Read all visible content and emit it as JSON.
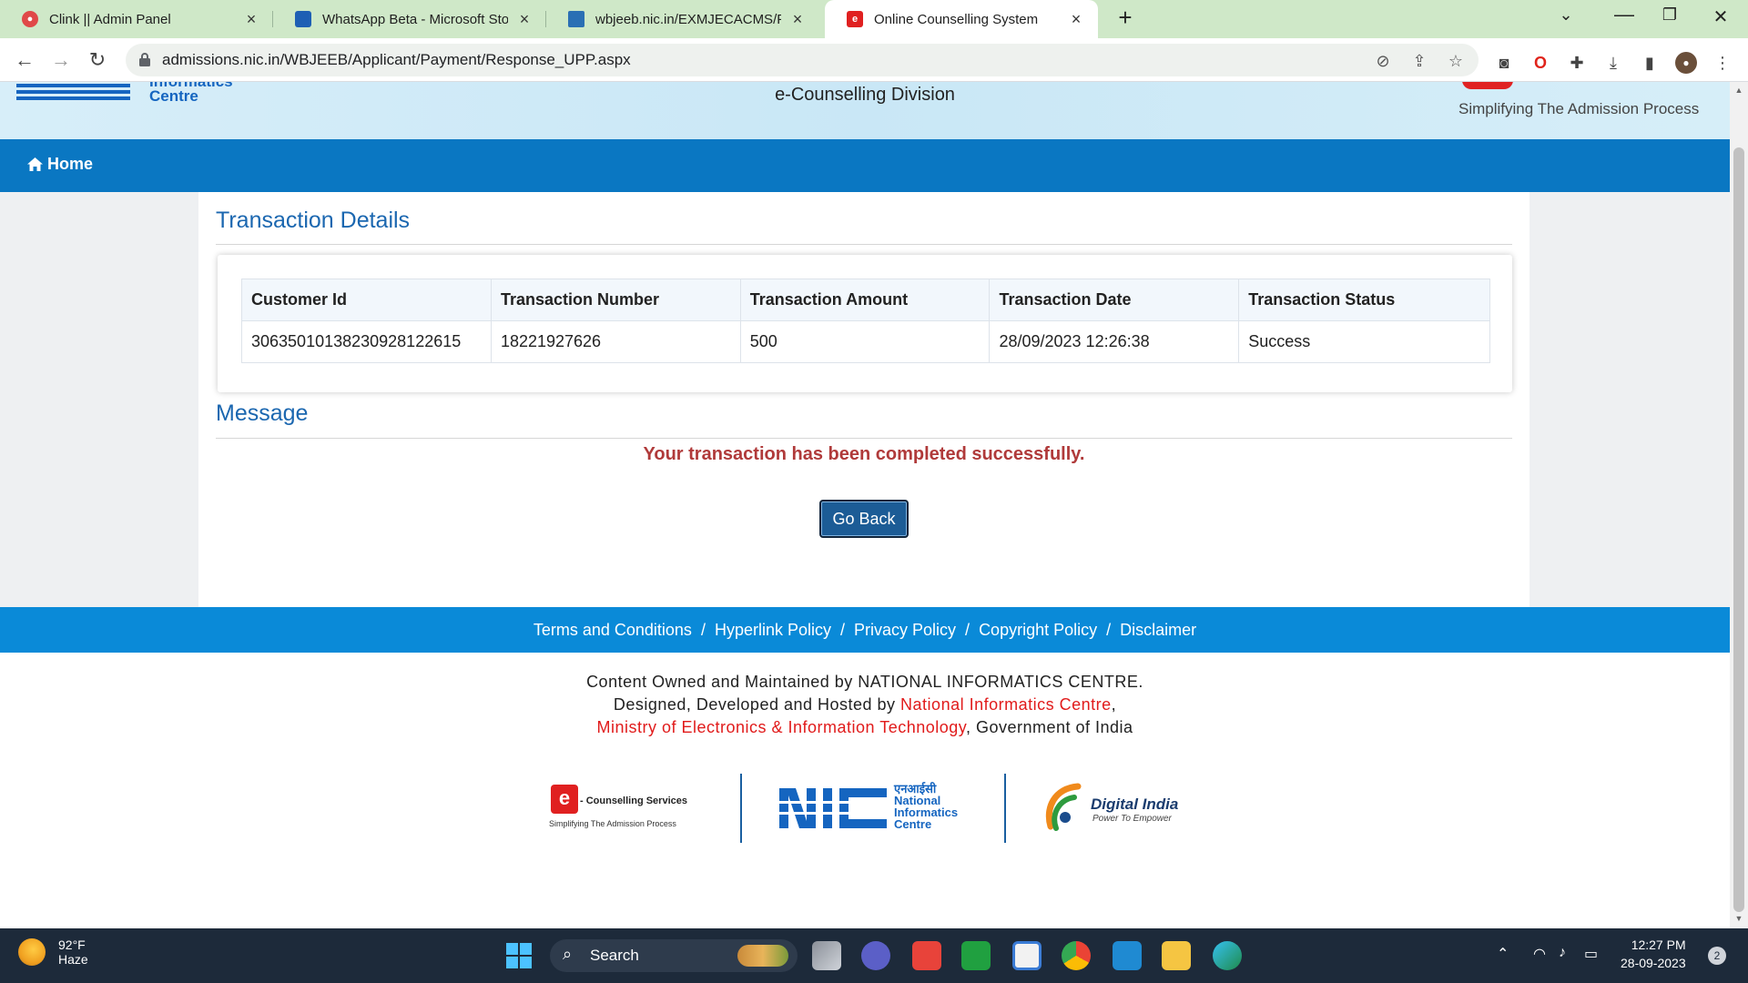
{
  "browser": {
    "tabs": [
      {
        "label": "Clink || Admin Panel",
        "close": "×"
      },
      {
        "label": "WhatsApp Beta - Microsoft Store",
        "close": "×"
      },
      {
        "label": "wbjeeb.nic.in/EXMJECACMS/Page",
        "close": "×"
      },
      {
        "label": "Online Counselling System",
        "close": "×",
        "active": true
      }
    ],
    "new_tab": "+",
    "url": "admissions.nic.in/WBJEEB/Applicant/Payment/Response_UPP.aspx"
  },
  "header": {
    "nic_logo_text_line1": "Informatics",
    "nic_logo_text_line2": "Centre",
    "division": "e-Counselling Division",
    "tagline": "Simplifying The Admission Process"
  },
  "nav": {
    "home": "Home"
  },
  "transaction": {
    "section_title": "Transaction Details",
    "columns": [
      "Customer Id",
      "Transaction Number",
      "Transaction Amount",
      "Transaction Date",
      "Transaction Status"
    ],
    "row": [
      "30635010138230928122615",
      "18221927626",
      "500",
      "28/09/2023 12:26:38",
      "Success"
    ]
  },
  "message": {
    "section_title": "Message",
    "text": "Your transaction has been completed successfully.",
    "button": "Go Back"
  },
  "footer": {
    "links": [
      "Terms and Conditions",
      "Hyperlink Policy",
      "Privacy Policy",
      "Copyright Policy",
      "Disclaimer"
    ],
    "separator": "/",
    "line1": "Content Owned and Maintained by NATIONAL INFORMATICS CENTRE.",
    "line2_prefix": "Designed, Developed and Hosted by ",
    "line2_link": "National Informatics Centre",
    "line2_suffix": ",",
    "line3_link": "Ministry of Electronics & Information Technology",
    "line3_suffix": ", Government of India",
    "logo1_title": "- Counselling Services",
    "logo1_sub": "Simplifying The Admission Process",
    "logo2_hindi": "एनआईसी",
    "logo2_line1": "National",
    "logo2_line2": "Informatics",
    "logo2_line3": "Centre",
    "logo3_title": "Digital India",
    "logo3_sub": "Power To Empower"
  },
  "taskbar": {
    "temperature": "92°F",
    "weather": "Haze",
    "search": "Search",
    "time": "12:27 PM",
    "date": "28-09-2023",
    "notifications": "2"
  },
  "colors": {
    "navbar": "#0a77c2",
    "section_title": "#1b67b0",
    "success_text": "#b03a3a",
    "footer_bar": "#0a8ad8",
    "accent_red": "#e11b1b"
  }
}
